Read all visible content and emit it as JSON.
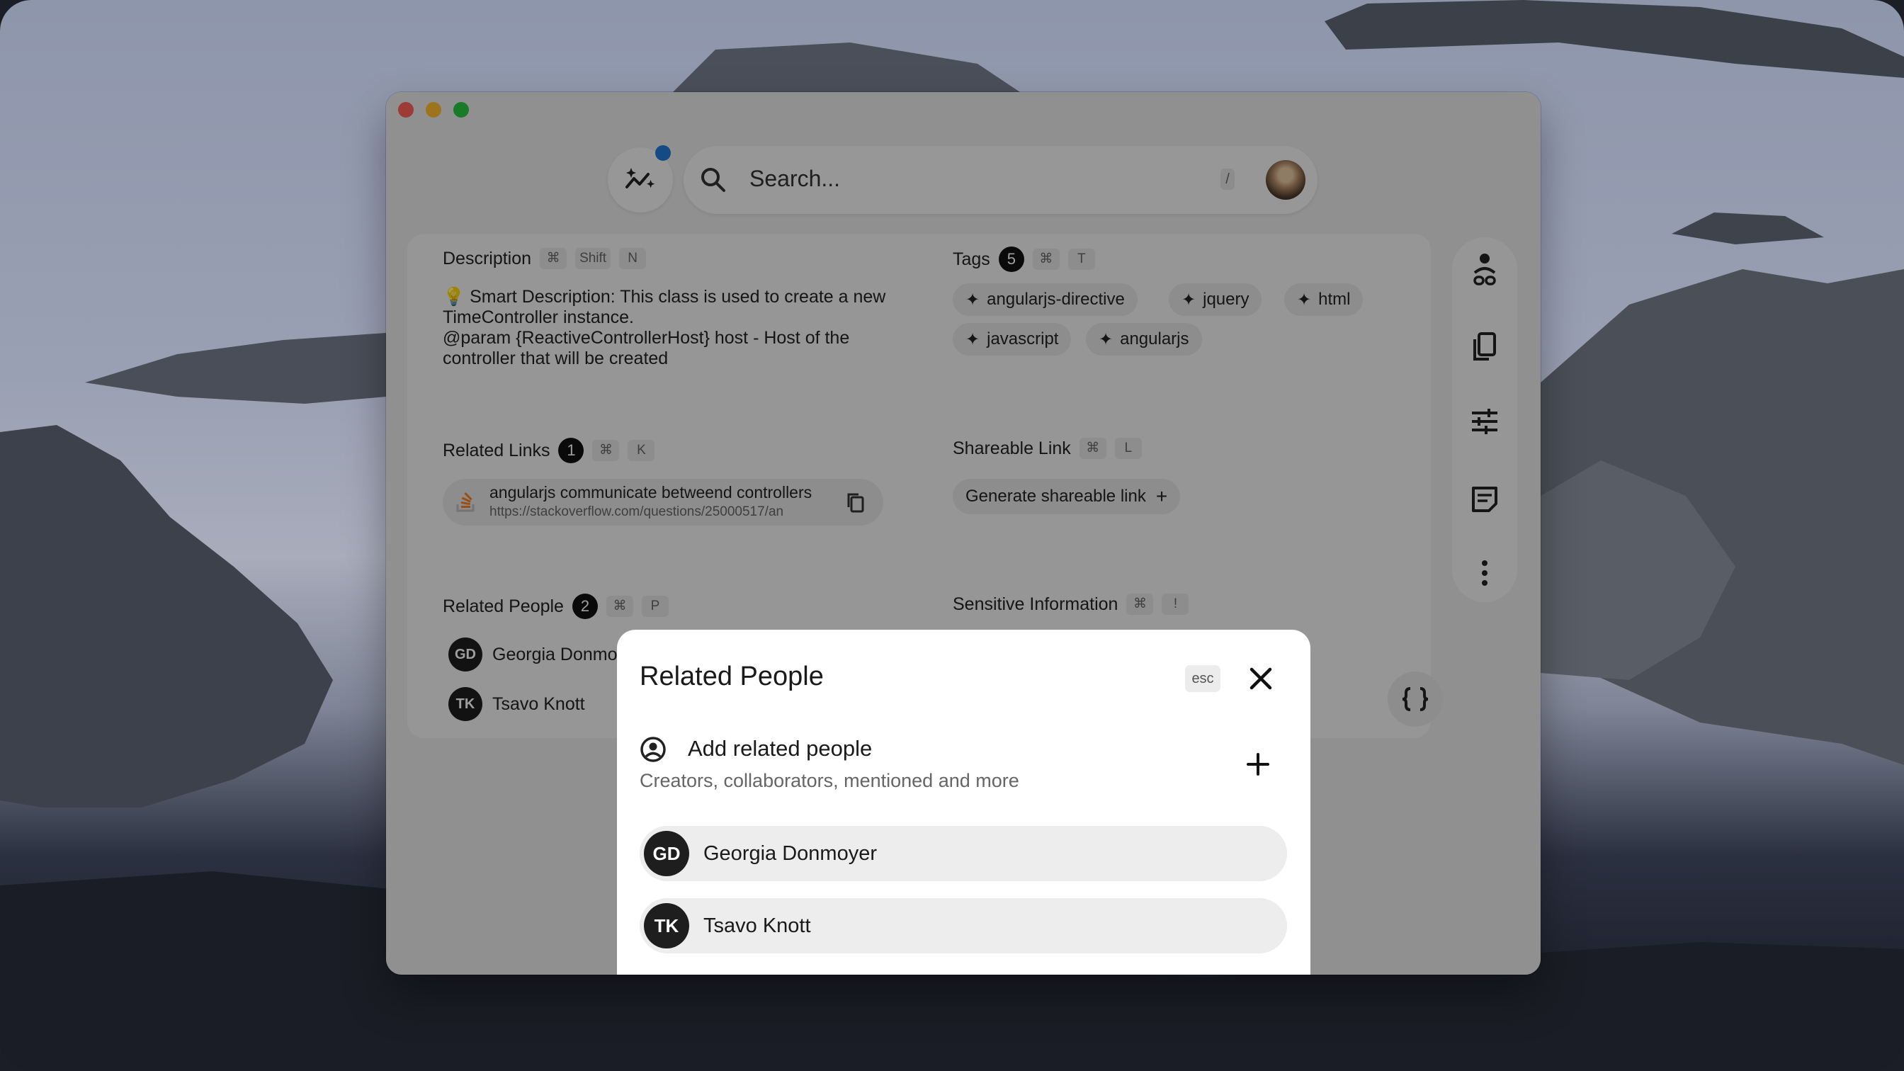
{
  "search": {
    "placeholder": "Search...",
    "shortcut": "/"
  },
  "sections": {
    "description": {
      "title": "Description",
      "keys": [
        "⌘",
        "Shift",
        "N"
      ],
      "text_line1": "Smart Description: This class is used to create a new TimeController instance.",
      "text_line2": "@param {ReactiveControllerHost} host - Host of the controller that will be created"
    },
    "tags": {
      "title": "Tags",
      "count": "5",
      "keys": [
        "⌘",
        "T"
      ],
      "items": [
        "angularjs-directive",
        "jquery",
        "html",
        "javascript",
        "angularjs"
      ]
    },
    "related_links": {
      "title": "Related Links",
      "count": "1",
      "keys": [
        "⌘",
        "K"
      ],
      "link_title": "angularjs communicate betweend controllers",
      "link_url": "https://stackoverflow.com/questions/25000517/an"
    },
    "shareable_link": {
      "title": "Shareable Link",
      "keys": [
        "⌘",
        "L"
      ],
      "button_label": "Generate shareable link"
    },
    "related_people": {
      "title": "Related People",
      "count": "2",
      "keys": [
        "⌘",
        "P"
      ],
      "people": [
        {
          "initials": "GD",
          "name": "Georgia Donmo"
        },
        {
          "initials": "TK",
          "name": "Tsavo Knott"
        }
      ]
    },
    "sensitive": {
      "title": "Sensitive Information",
      "keys": [
        "⌘",
        "!"
      ]
    }
  },
  "modal": {
    "title": "Related People",
    "esc_label": "esc",
    "add_title": "Add related people",
    "add_subtitle": "Creators, collaborators, mentioned and more",
    "people": [
      {
        "initials": "GD",
        "name": "Georgia Donmoyer"
      },
      {
        "initials": "TK",
        "name": "Tsavo Knott"
      }
    ]
  },
  "icons": {
    "logo": "sparkle-chart-icon",
    "search": "search-icon",
    "rail": [
      "person-link-icon",
      "copy-icon",
      "sliders-icon",
      "note-icon",
      "more-vertical-icon"
    ],
    "braces": "code-braces-icon"
  },
  "colors": {
    "accent_dot": "#1f7ad6",
    "overlay": "rgba(0,0,0,0.38)"
  }
}
